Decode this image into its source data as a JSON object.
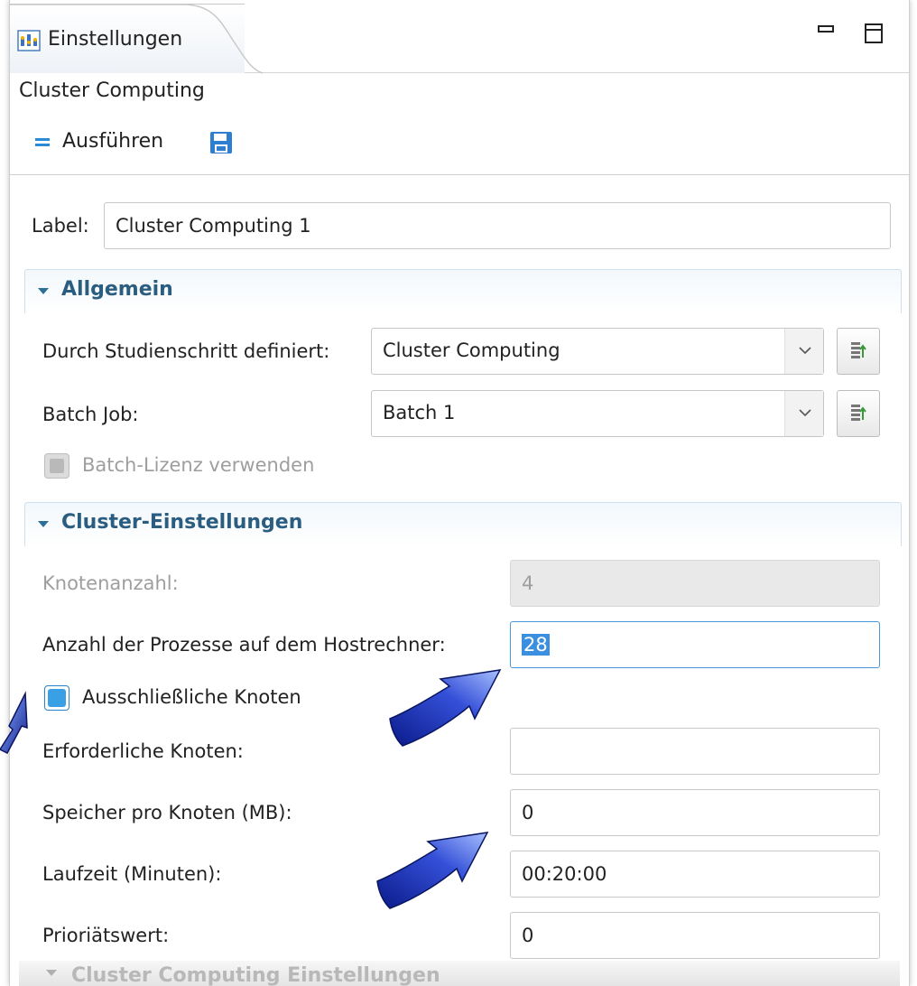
{
  "tab": {
    "title": "Einstellungen",
    "icon": "settings-panel-icon"
  },
  "window_controls": {
    "minimize_icon": "minimize-icon",
    "maximize_icon": "maximize-icon"
  },
  "view": {
    "title": "Cluster Computing"
  },
  "toolbar": {
    "run_label": "Ausführen",
    "run_icon": "run-icon",
    "save_icon": "save-icon"
  },
  "label_field": {
    "label": "Label:",
    "value": "Cluster Computing 1"
  },
  "section_general": {
    "title": "Allgemein",
    "study_step": {
      "label": "Durch Studienschritt definiert:",
      "value": "Cluster Computing"
    },
    "batch_job": {
      "label": "Batch Job:",
      "value": "Batch 1"
    },
    "batch_license": {
      "label": "Batch-Lizenz verwenden",
      "checked": false,
      "enabled": false
    }
  },
  "section_cluster": {
    "title": "Cluster-Einstellungen",
    "node_count": {
      "label": "Knotenanzahl:",
      "value": "4",
      "enabled": false
    },
    "processes_per_host": {
      "label": "Anzahl der Prozesse auf dem Hostrechner:",
      "value": "28"
    },
    "exclusive_nodes": {
      "label": "Ausschließliche Knoten",
      "checked": true
    },
    "required_nodes": {
      "label": "Erforderliche Knoten:",
      "value": ""
    },
    "memory_per_node": {
      "label": "Speicher pro Knoten (MB):",
      "value": "0"
    },
    "runtime": {
      "label": "Laufzeit (Minuten):",
      "value": "00:20:00"
    },
    "priority": {
      "label": "Prioriätswert:",
      "value": "0"
    }
  },
  "section_next": {
    "title": "Cluster Computing Einstellungen"
  },
  "colors": {
    "accent": "#2a5d80",
    "selection": "#3a8fe0",
    "arrow": "#1a2aa8"
  }
}
